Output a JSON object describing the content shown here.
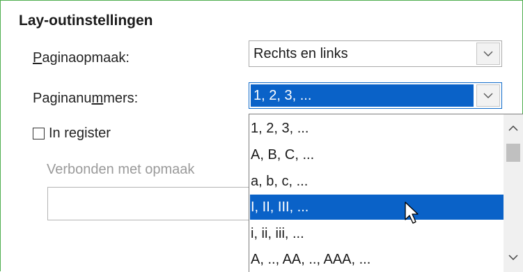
{
  "section": {
    "title": "Lay-outinstellingen"
  },
  "page_layout": {
    "label_prefix": "P",
    "label_rest": "aginaopmaak:",
    "value": "Rechts en links"
  },
  "page_numbers": {
    "label_prefix": "Paginanu",
    "label_underlined": "m",
    "label_rest": "mers:",
    "value": "1, 2, 3, ..."
  },
  "in_register": {
    "label_prefix": "In re",
    "label_underlined": "g",
    "label_rest": "ister",
    "checked": false
  },
  "linked_style": {
    "label": "Verbonden met opmaak",
    "value": ""
  },
  "dropdown": {
    "options": [
      "1, 2, 3, ...",
      "A, B, C, ...",
      "a, b, c, ...",
      "I, II, III, ...",
      "i, ii, iii, ...",
      "A, .., AA, .., AAA, ..."
    ],
    "highlighted_index": 3
  },
  "colors": {
    "accent": "#0a62c8",
    "frame": "#4fae4f"
  },
  "icons": {
    "combo_button": "chevron-down-icon",
    "scroll_up": "chevron-up-icon",
    "scroll_down": "chevron-down-icon",
    "cursor": "arrow-cursor-icon"
  }
}
